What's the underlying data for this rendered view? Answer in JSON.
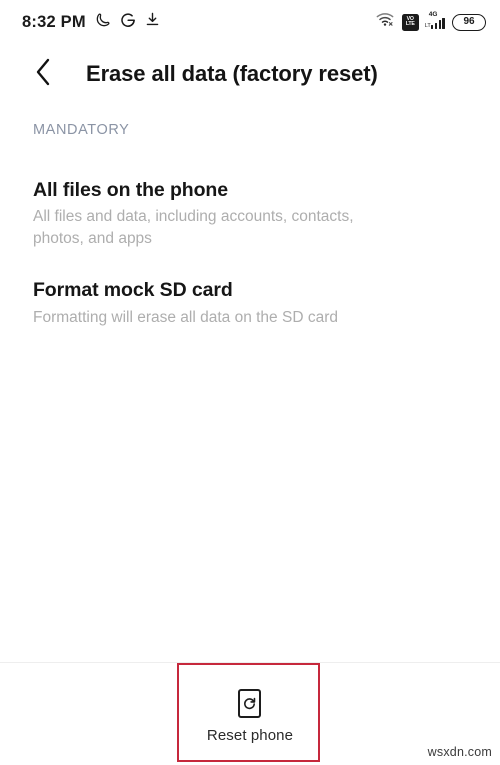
{
  "status_bar": {
    "clock": "8:32 PM",
    "left_icons": [
      "moon-icon",
      "google-icon",
      "download-icon"
    ],
    "wifi_icon": "wifi-icon",
    "volte_line1": "VO",
    "volte_line2": "LTE",
    "network_type": "4G",
    "network_sub": "LT",
    "signal_icon": "signal-bars-icon",
    "battery_level": "96"
  },
  "app_bar": {
    "back_icon": "back-chevron-icon",
    "title": "Erase all data (factory reset)"
  },
  "content": {
    "section_header": "MANDATORY",
    "options": [
      {
        "title": "All files on the phone",
        "description": "All files and data, including accounts, contacts, photos, and apps"
      },
      {
        "title": "Format mock SD card",
        "description": "Formatting will erase all data on the SD card"
      }
    ]
  },
  "bottom_bar": {
    "reset_icon": "phone-refresh-icon",
    "reset_label": "Reset phone"
  },
  "annotation": {
    "highlight_color": "#c6283c"
  },
  "watermark": {
    "text": "wsxdn.com"
  }
}
